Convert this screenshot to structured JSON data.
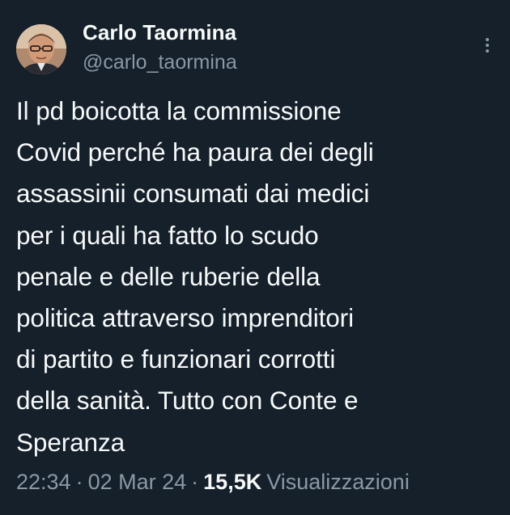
{
  "author": {
    "display_name": "Carlo Taormina",
    "handle": "@carlo_taormina"
  },
  "tweet": {
    "text": "Il pd boicotta la commissione\nCovid perché ha paura dei degli\nassassinii consumati dai medici\nper i quali ha fatto lo scudo\npenale e delle ruberie della\npolitica attraverso imprenditori\ndi partito e funzionari corrotti\ndella sanità. Tutto con Conte e\nSperanza"
  },
  "meta": {
    "time": "22:34",
    "separator": "·",
    "date": "02 Mar 24",
    "views_count": "15,5K",
    "views_label": "Visualizzazioni"
  },
  "icons": {
    "more": "more-vertical-icon"
  },
  "colors": {
    "background": "#15202b",
    "primary_text": "#f7f9f9",
    "secondary_text": "#8b98a5"
  }
}
